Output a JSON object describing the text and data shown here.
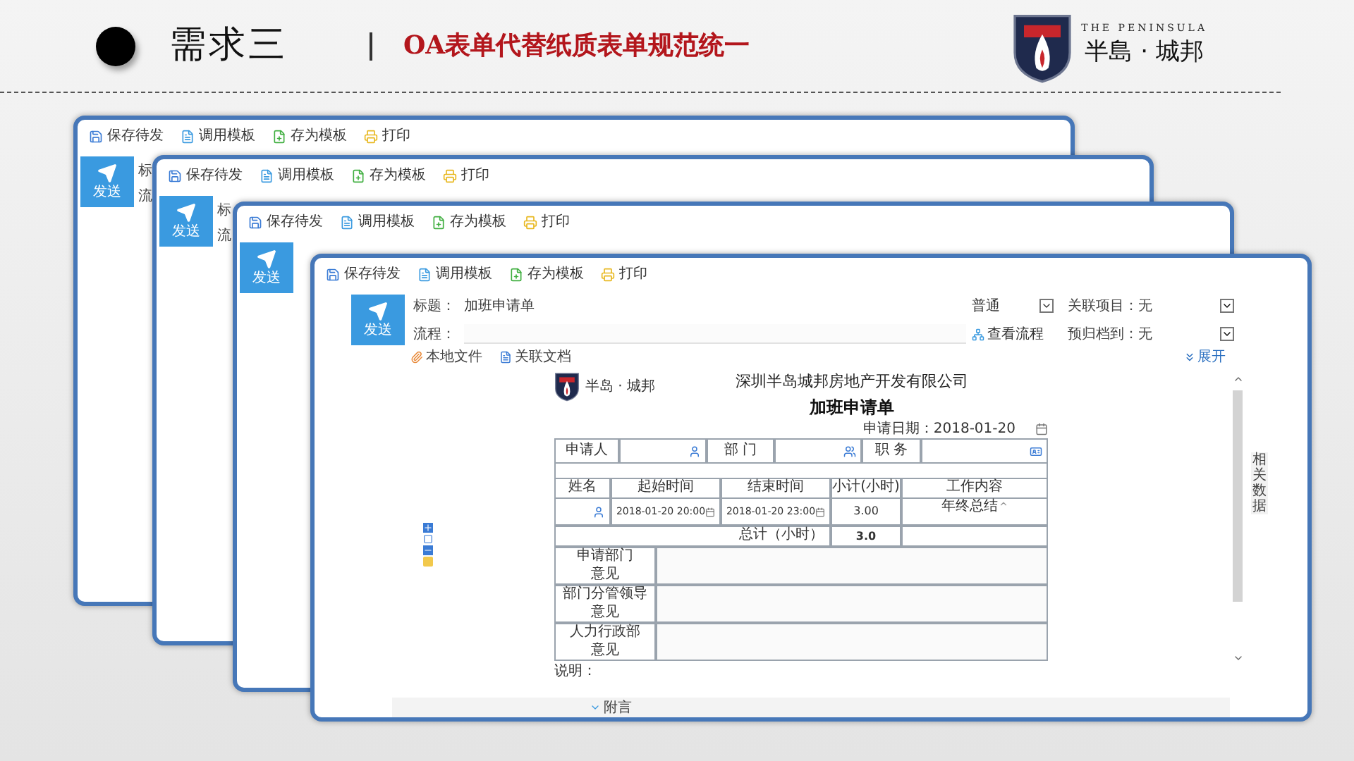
{
  "header": {
    "section": "需求三",
    "title": "OA表单代替纸质表单规范统一",
    "logo": {
      "tagline": "THE PENINSULA",
      "name": "半島 · 城邦"
    }
  },
  "back_windows": [
    {
      "toolbar": [
        {
          "kind": "save",
          "label": "保存待发"
        },
        {
          "kind": "template",
          "label": "调用模板"
        },
        {
          "kind": "save_template",
          "label": "存为模板"
        },
        {
          "kind": "print",
          "label": "打印"
        }
      ],
      "send": "发送",
      "labels": [
        "标",
        "流"
      ]
    },
    {
      "toolbar": [
        {
          "kind": "save",
          "label": "保存待发"
        },
        {
          "kind": "template",
          "label": "调用模板"
        },
        {
          "kind": "save_template",
          "label": "存为模板"
        },
        {
          "kind": "print",
          "label": "打印"
        }
      ],
      "send": "发送",
      "labels": [
        "标",
        "流"
      ]
    },
    {
      "toolbar": [
        {
          "kind": "save",
          "label": "保存待发"
        },
        {
          "kind": "template",
          "label": "调用模板"
        },
        {
          "kind": "save_template",
          "label": "存为模板"
        },
        {
          "kind": "print",
          "label": "打印"
        }
      ],
      "send": "发送"
    }
  ],
  "main_window": {
    "toolbar": [
      {
        "kind": "save",
        "label": "保存待发"
      },
      {
        "kind": "template",
        "label": "调用模板"
      },
      {
        "kind": "save_template",
        "label": "存为模板"
      },
      {
        "kind": "print",
        "label": "打印"
      }
    ],
    "send": "发送",
    "subject": {
      "label": "标题：",
      "value": "加班申请单"
    },
    "flow": {
      "label": "流程："
    },
    "priority": "普通",
    "view_flow": "查看流程",
    "related_project": {
      "label": "关联项目：",
      "value": "无"
    },
    "archive": {
      "label": "预归档到：",
      "value": "无"
    },
    "attachments": [
      {
        "kind": "file",
        "label": "本地文件"
      },
      {
        "kind": "doc",
        "label": "关联文档"
      }
    ],
    "expand": "展开",
    "side_tab": "相关数据",
    "postscript": "附言",
    "document": {
      "logo_name": "半岛 · 城邦",
      "company": "深圳半岛城邦房地产开发有限公司",
      "title": "加班申请单",
      "date_label": "申请日期：",
      "date": "2018-01-20",
      "info": [
        "申请人",
        "部 门",
        "职 务"
      ],
      "columns": [
        "姓名",
        "起始时间",
        "结束时间",
        "小计(小时)",
        "工作内容"
      ],
      "rows": [
        {
          "start": "2018-01-20 20:00",
          "end": "2018-01-20 23:00",
          "hours": "3.00",
          "content": "年终总结"
        }
      ],
      "total_label": "总计（小时）",
      "total": "3.0",
      "opinions": [
        [
          "申请部门",
          "意见"
        ],
        [
          "部门分管领导",
          "意见"
        ],
        [
          "人力行政部",
          "意见"
        ]
      ],
      "note_label": "说明："
    }
  }
}
